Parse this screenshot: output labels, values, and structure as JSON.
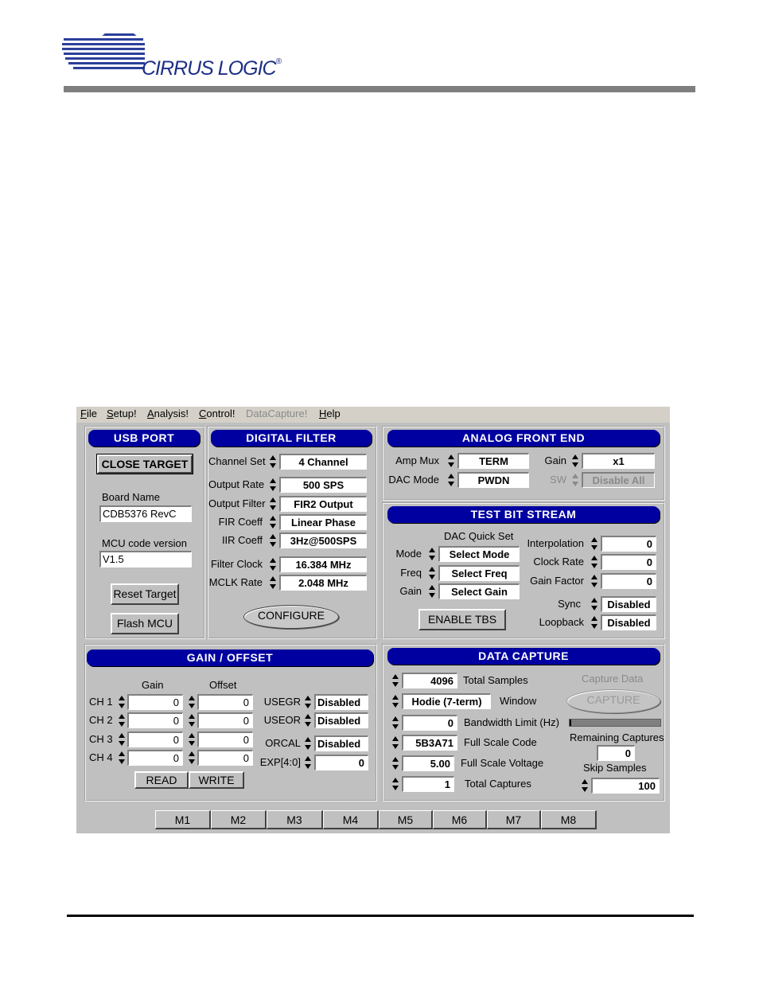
{
  "header": {
    "company": "CIRRUS LOGIC",
    "registered": "®"
  },
  "menu": [
    {
      "label": "File",
      "enabled": true
    },
    {
      "label": "Setup!",
      "enabled": true
    },
    {
      "label": "Analysis!",
      "enabled": true
    },
    {
      "label": "Control!",
      "enabled": true
    },
    {
      "label": "DataCapture!",
      "enabled": false
    },
    {
      "label": "Help",
      "enabled": true
    }
  ],
  "usb": {
    "title": "USB PORT",
    "close_target": "CLOSE TARGET",
    "board_name_label": "Board Name",
    "board_name": "CDB5376 RevC",
    "mcu_label": "MCU code version",
    "mcu_version": "V1.5",
    "reset_target": "Reset Target",
    "flash_mcu": "Flash MCU"
  },
  "digital_filter": {
    "title": "DIGITAL FILTER",
    "rows": [
      {
        "label": "Channel Set",
        "value": "4 Channel"
      },
      {
        "label": "Output Rate",
        "value": "500 SPS"
      },
      {
        "label": "Output Filter",
        "value": "FIR2 Output"
      },
      {
        "label": "FIR Coeff",
        "value": "Linear Phase"
      },
      {
        "label": "IIR Coeff",
        "value": "3Hz@500SPS"
      },
      {
        "label": "Filter Clock",
        "value": "16.384 MHz"
      },
      {
        "label": "MCLK Rate",
        "value": "2.048 MHz"
      }
    ],
    "configure": "CONFIGURE"
  },
  "afe": {
    "title": "ANALOG FRONT END",
    "amp_mux_label": "Amp Mux",
    "amp_mux": "TERM",
    "dac_mode_label": "DAC Mode",
    "dac_mode": "PWDN",
    "gain_label": "Gain",
    "gain": "x1",
    "sw_label": "SW",
    "sw": "Disable All"
  },
  "tbs": {
    "title": "TEST BIT STREAM",
    "quick_set_label": "DAC Quick Set",
    "mode_label": "Mode",
    "mode": "Select Mode",
    "freq_label": "Freq",
    "freq": "Select Freq",
    "gain_label": "Gain",
    "gain": "Select Gain",
    "interp_label": "Interpolation",
    "interp": "0",
    "clock_label": "Clock Rate",
    "clock": "0",
    "gainf_label": "Gain Factor",
    "gainf": "0",
    "sync_label": "Sync",
    "sync": "Disabled",
    "loop_label": "Loopback",
    "loop": "Disabled",
    "enable": "ENABLE TBS"
  },
  "gain_offset": {
    "title": "GAIN / OFFSET",
    "gain_header": "Gain",
    "offset_header": "Offset",
    "channels": [
      {
        "label": "CH 1",
        "gain": "0",
        "offset": "0"
      },
      {
        "label": "CH 2",
        "gain": "0",
        "offset": "0"
      },
      {
        "label": "CH 3",
        "gain": "0",
        "offset": "0"
      },
      {
        "label": "CH 4",
        "gain": "0",
        "offset": "0"
      }
    ],
    "usegr_label": "USEGR",
    "usegr": "Disabled",
    "useor_label": "USEOR",
    "useor": "Disabled",
    "orcal_label": "ORCAL",
    "orcal": "Disabled",
    "exp_label": "EXP[4:0]",
    "exp": "0",
    "read": "READ",
    "write": "WRITE"
  },
  "capture": {
    "title": "DATA CAPTURE",
    "total_samples": "4096",
    "total_samples_label": "Total Samples",
    "window": "Hodie (7-term)",
    "window_label": "Window",
    "bandwidth": "0",
    "bandwidth_label": "Bandwidth Limit (Hz)",
    "full_scale_code": "5B3A71",
    "full_scale_code_label": "Full Scale Code",
    "full_scale_voltage": "5.00",
    "full_scale_voltage_label": "Full Scale Voltage",
    "total_captures": "1",
    "total_captures_label": "Total Captures",
    "capture_data_label": "Capture Data",
    "capture_button": "CAPTURE",
    "progress": 0.02,
    "remaining_label": "Remaining Captures",
    "remaining": "0",
    "skip_label": "Skip Samples",
    "skip": "100"
  },
  "macros": [
    "M1",
    "M2",
    "M3",
    "M4",
    "M5",
    "M6",
    "M7",
    "M8"
  ]
}
